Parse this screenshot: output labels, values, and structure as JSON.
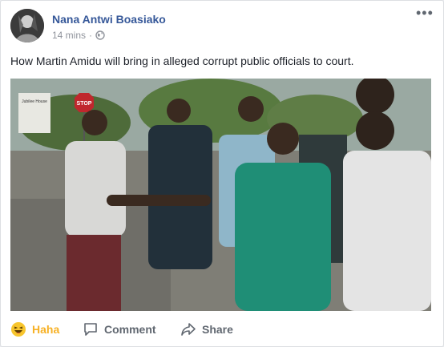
{
  "post": {
    "author": "Nana Antwi Boasiako",
    "timestamp": "14 mins",
    "separator": "·",
    "privacy_icon": "globe-icon",
    "text": "How Martin Amidu will bring in alleged corrupt public officials to court.",
    "more_label": "•••"
  },
  "photo": {
    "sign_text": "STOP",
    "building_sign_text": "Jubilee House"
  },
  "actions": {
    "reaction_label": "Haha",
    "reaction_icon": "haha-emoji-icon",
    "comment_label": "Comment",
    "comment_icon": "speech-bubble-icon",
    "share_label": "Share",
    "share_icon": "share-arrow-icon"
  },
  "colors": {
    "author_link": "#365899",
    "haha": "#f7b125",
    "muted": "#606770"
  }
}
